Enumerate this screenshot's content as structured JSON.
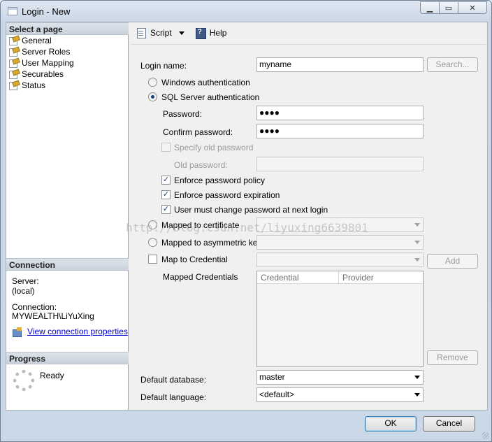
{
  "window": {
    "title": "Login - New"
  },
  "left": {
    "select_page_header": "Select a page",
    "pages": [
      {
        "label": "General",
        "icon": "page-icon"
      },
      {
        "label": "Server Roles",
        "icon": "page-icon"
      },
      {
        "label": "User Mapping",
        "icon": "page-icon"
      },
      {
        "label": "Securables",
        "icon": "page-icon"
      },
      {
        "label": "Status",
        "icon": "page-icon"
      }
    ],
    "connection_header": "Connection",
    "server_label": "Server:",
    "server_value": "(local)",
    "connection_label": "Connection:",
    "connection_value": "MYWEALTH\\LiYuXing",
    "view_conn_link": "View connection properties",
    "progress_header": "Progress",
    "progress_status": "Ready"
  },
  "toolbar": {
    "script_label": "Script",
    "help_label": "Help"
  },
  "form": {
    "login_name_label": "Login name:",
    "login_name_value": "myname",
    "search_button": "Search...",
    "windows_auth": "Windows authentication",
    "sql_auth": "SQL Server authentication",
    "password_label": "Password:",
    "password_value": "●●●●",
    "confirm_label": "Confirm password:",
    "confirm_value": "●●●●",
    "specify_old": "Specify old password",
    "old_password_label": "Old password:",
    "enforce_policy": "Enforce password policy",
    "enforce_expiration": "Enforce password expiration",
    "must_change": "User must change password at next login",
    "mapped_cert": "Mapped to certificate",
    "mapped_asym": "Mapped to asymmetric key",
    "map_credential": "Map to Credential",
    "add_button": "Add",
    "mapped_credentials_label": "Mapped Credentials",
    "cred_columns": [
      "Credential",
      "Provider"
    ],
    "remove_button": "Remove",
    "default_db_label": "Default database:",
    "default_db_value": "master",
    "default_lang_label": "Default language:",
    "default_lang_value": "<default>"
  },
  "footer": {
    "ok": "OK",
    "cancel": "Cancel"
  },
  "watermark": "http://blog.csdn.net/liyuxing6639801"
}
